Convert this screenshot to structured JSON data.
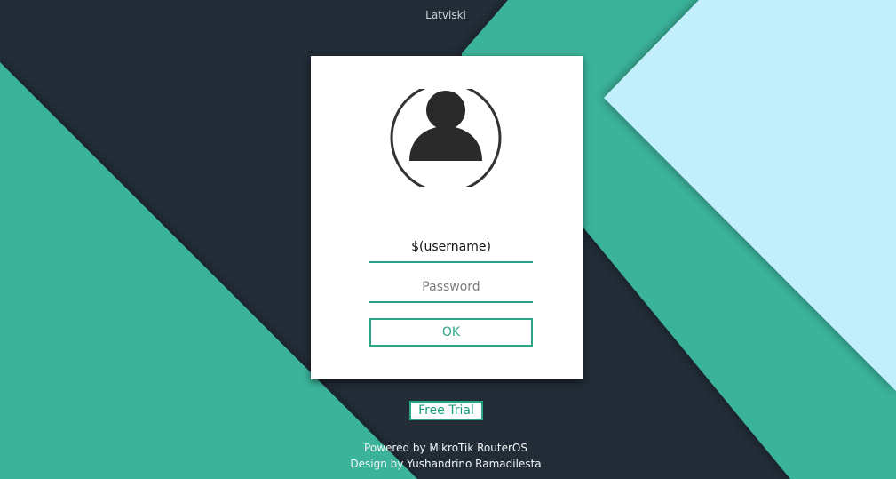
{
  "header": {
    "language_link": "Latviski"
  },
  "login_card": {
    "avatar_icon": "user-avatar-icon",
    "username_value": "$(username)",
    "password_placeholder": "Password",
    "ok_label": "OK"
  },
  "free_trial_label": "Free Trial",
  "footer": {
    "powered_by": "Powered by MikroTik RouterOS",
    "design_by": "Design by Yushandrino Ramadilesta"
  },
  "colors": {
    "dark_background": "#212c37",
    "teal": "#3bb39b",
    "light_blue": "#c3eefc",
    "accent": "#2aa586"
  }
}
